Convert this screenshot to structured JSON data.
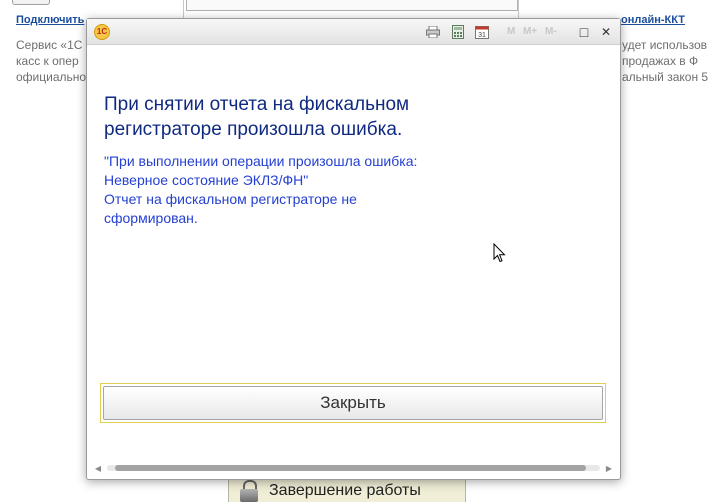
{
  "background": {
    "link_left": "Подключить",
    "link_right": "онлайн-ККТ",
    "desc_left": [
      "Сервис «1С",
      "касс к опер",
      "официально"
    ],
    "desc_right": [
      "удет использов",
      "продажах в Ф",
      "альный закон 5"
    ],
    "bottom_button_label": "Завершение работы",
    "bottom_button_icon": "lock-icon"
  },
  "dialog": {
    "app_icon_text": "1С",
    "toolbar_icons": [
      "print-icon",
      "calculator-icon",
      "calendar-icon"
    ],
    "calendar_day": "31",
    "memory_buttons": [
      "M",
      "M+",
      "M-"
    ],
    "window_buttons": [
      "maximize-icon",
      "close-icon"
    ],
    "maximize_glyph": "□",
    "close_glyph": "✕",
    "title_lines": [
      "При снятии отчета на фискальном",
      "регистраторе произошла ошибка."
    ],
    "detail_lines": [
      "\"При выполнении операции произошла ошибка:",
      "Неверное состояние ЭКЛЗ/ФН\"",
      "Отчет на фискальном регистраторе не",
      "сформирован."
    ],
    "close_button_label": "Закрыть",
    "scroll_left_glyph": "◀",
    "scroll_right_glyph": "▶"
  },
  "colors": {
    "title_text": "#102a80",
    "detail_text": "#2540d2",
    "focus_frame": "#e2ce4e",
    "link": "#1c4d9c"
  }
}
